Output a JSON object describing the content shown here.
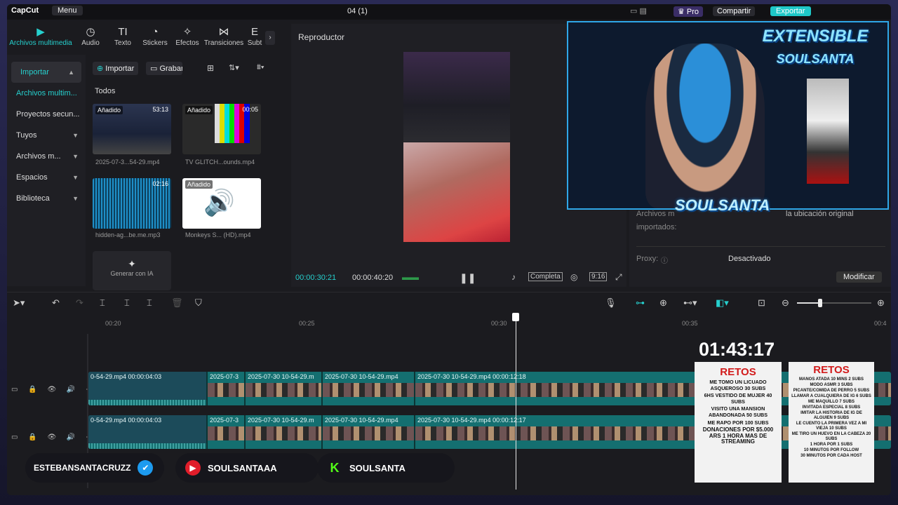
{
  "app": {
    "logo": "CapCut",
    "menu": "Menu",
    "project_title": "04 (1)",
    "pro": "♛ Pro",
    "share": "Compartir",
    "export": "Exportar"
  },
  "tooltabs": [
    {
      "label": "Archivos multimedia",
      "icon": "media-icon"
    },
    {
      "label": "Audio",
      "icon": "audio-icon"
    },
    {
      "label": "Texto",
      "icon": "text-icon"
    },
    {
      "label": "Stickers",
      "icon": "sticker-icon"
    },
    {
      "label": "Efectos",
      "icon": "effects-icon"
    },
    {
      "label": "Transiciones",
      "icon": "transition-icon"
    },
    {
      "label": "Subt",
      "icon": "subtitle-icon"
    }
  ],
  "sidebar": {
    "items": [
      {
        "label": "Importar"
      },
      {
        "label": "Archivos multim..."
      },
      {
        "label": "Proyectos secun..."
      },
      {
        "label": "Tuyos"
      },
      {
        "label": "Archivos m..."
      },
      {
        "label": "Espacios"
      },
      {
        "label": "Biblioteca"
      }
    ]
  },
  "media": {
    "import_btn": "Importar",
    "record_btn": "Grabar",
    "section": "Todos",
    "items": [
      {
        "badge": "Añadido",
        "duration": "53:13",
        "label": "2025-07-3...54-29.mp4"
      },
      {
        "badge": "Añadido",
        "duration": "00:05",
        "label": "TV GLITCH...ounds.mp4"
      },
      {
        "badge": "",
        "duration": "02:16",
        "label": "hidden-ag...be.me.mp3"
      },
      {
        "badge": "Añadido",
        "duration": "",
        "label": "Monkeys S... (HD).mp4"
      }
    ],
    "generate": "Generar con IA"
  },
  "player": {
    "title": "Reproductor",
    "current_time": "00:00:30:21",
    "total_time": "00:00:40:20",
    "quality": "Completa",
    "ratio": "9:16"
  },
  "details": {
    "path_label": "Archivos m",
    "path_value": "la ubicación original",
    "imported": "importados:",
    "proxy_label": "Proxy:",
    "proxy_value": "Desactivado",
    "modify": "Modificar"
  },
  "timeline": {
    "ruler": [
      "00:20",
      "00:25",
      "00:30",
      "00:35",
      "00:4"
    ],
    "track1": [
      {
        "label": "0-54-29.mp4   00:00:04:03"
      },
      {
        "label": "2025-07-3"
      },
      {
        "label": "2025-07-30 10-54-29.m"
      },
      {
        "label": "2025-07-30 10-54-29.mp4"
      },
      {
        "label": "2025-07-30 10-54-29.mp4   00:00:12:18"
      }
    ],
    "track2": [
      {
        "label": "0-54-29.mp4   00:00:04:03"
      },
      {
        "label": "2025-07-3"
      },
      {
        "label": "2025-07-30 10-54-29.m"
      },
      {
        "label": "2025-07-30 10-54-29.mp4"
      },
      {
        "label": "2025-07-30 10-54-29.mp4   00:00:12:17"
      }
    ]
  },
  "overlay": {
    "timer": "01:43:17",
    "brand_top": "EXTENSIBLE",
    "brand_bottom": "SOULSANTA",
    "webcam_name": "SOULSANTA",
    "posters": [
      {
        "title": "RETOS",
        "lines": [
          "ME TOMO UN LICUADO ASQUEROSO 30 SUBS",
          "6HS VESTIDO DE MUJER 40 SUBS",
          "VISITO UNA MANSION ABANDONADA 50 SUBS",
          "ME RAPO POR 100 SUBS",
          "DONACIONES POR $5.000 ARS 1 HORA MAS DE STREAMING"
        ]
      },
      {
        "title": "RETOS",
        "lines": [
          "MANOS ATADA 10 MINS 2 SUBS",
          "MODO ASMR 3 SUBS",
          "PICANTE/COMIDA DE PERRO 5 SUBS",
          "LLAMAR A CUALQUIERA DE IG 6 SUBS",
          "ME MAQUILLO 7 SUBS",
          "INVITADA ESPECIAL 8 SUBS",
          "IMITAR LA HISTORIA DE IG DE ALGUIEN 9 SUBS",
          "LE CUENTO LA PRIMERA VEZ A MI VIEJA 10 SUBS",
          "ME TIRO UN HUEVO EN LA CABEZA 20 SUBS",
          "1 HORA POR 1 SUBS",
          "10 MINUTOS POR FOLLOW",
          "30 MINUTOS POR CADA HOST"
        ]
      }
    ],
    "socials": [
      {
        "handle": "ESTEBANSANTACRUZZ",
        "icon": "verified-check-icon",
        "color": "#1d9bf0"
      },
      {
        "handle": "SOULSANTAAA",
        "icon": "youtube-play-icon",
        "color": "#e11d2a"
      },
      {
        "handle": "SOULSANTA",
        "icon": "kick-logo-icon",
        "color": "#53fc18"
      }
    ]
  }
}
